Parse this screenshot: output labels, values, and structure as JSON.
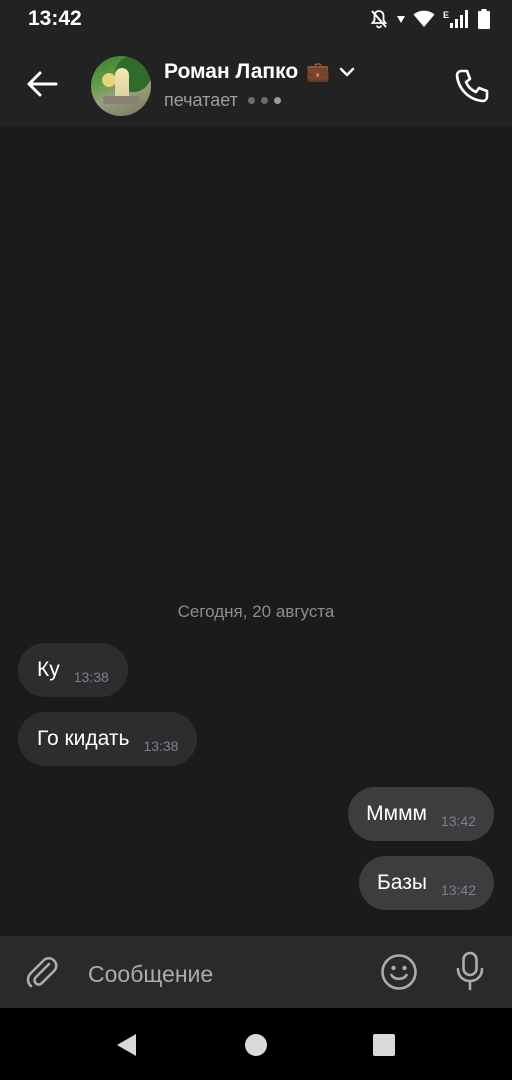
{
  "status_bar": {
    "time": "13:42",
    "network_label": "E",
    "icons": [
      "bell-off-icon",
      "signal-arrow-icon",
      "wifi-icon",
      "cell-signal-icon",
      "battery-icon"
    ]
  },
  "header": {
    "contact_name": "Роман Лапко",
    "name_emoji": "💼",
    "status": "печатает",
    "icons": [
      "back-arrow-icon",
      "chevron-down-icon",
      "phone-icon"
    ]
  },
  "chat": {
    "date_separator": "Сегодня, 20 августа",
    "messages": [
      {
        "direction": "incoming",
        "text": "Ку",
        "time": "13:38"
      },
      {
        "direction": "incoming",
        "text": "Го кидать",
        "time": "13:38"
      },
      {
        "direction": "outgoing",
        "text": "Мммм",
        "time": "13:42"
      },
      {
        "direction": "outgoing",
        "text": "Базы",
        "time": "13:42"
      }
    ]
  },
  "composer": {
    "placeholder": "Сообщение",
    "value": "",
    "icons": [
      "paperclip-icon",
      "emoji-icon",
      "microphone-icon"
    ]
  },
  "nav_bar": {
    "icons": [
      "nav-back-icon",
      "nav-home-icon",
      "nav-recents-icon"
    ]
  },
  "colors": {
    "background": "#1b1b1b",
    "header": "#222222",
    "incoming_bubble": "#2c2d2e",
    "outgoing_bubble": "#3c3d3f",
    "composer": "#2a2a2b"
  }
}
